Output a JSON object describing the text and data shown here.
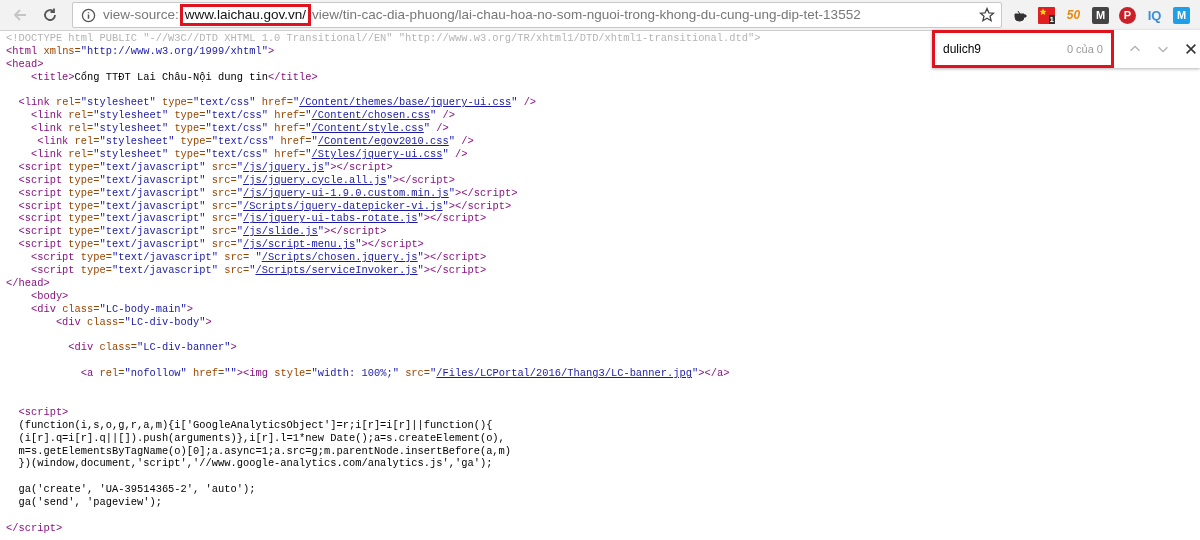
{
  "toolbar": {
    "back_disabled": true,
    "address": [
      {
        "kind": "scheme",
        "text": "view-source:",
        "highlighted": false
      },
      {
        "kind": "host",
        "text": "www.laichau.gov.vn/",
        "highlighted": true
      },
      {
        "kind": "path",
        "text": "view/tin-cac-dia-phuong/lai-chau-hoa-no-som-nguoi-trong-khong-du-cung-ung-dip-tet-13552",
        "highlighted": false
      }
    ],
    "extensions": [
      {
        "kind": "cup"
      },
      {
        "kind": "flag",
        "label": "1"
      },
      {
        "kind": "badge",
        "label": "50"
      },
      {
        "kind": "dark",
        "label": "M"
      },
      {
        "kind": "pin",
        "label": "P"
      },
      {
        "kind": "iq",
        "label": "IQ"
      },
      {
        "kind": "blue",
        "label": "M"
      }
    ]
  },
  "find_bar": {
    "value": "dulich9",
    "count": "0 của 0",
    "highlighted": true,
    "prev_disabled": true,
    "next_disabled": true
  },
  "lines": [
    {
      "kind": "code",
      "segs": [
        {
          "kind": "doc",
          "text": "<!DOCTYPE html PUBLIC \"-//W3C//DTD XHTML 1.0 Transitional//EN\" \"http://www.w3.org/TR/xhtml1/DTD/xhtml1-transitional.dtd\">"
        }
      ]
    },
    {
      "kind": "code",
      "segs": [
        {
          "kind": "tag",
          "text": "<html"
        },
        {
          "kind": "attr",
          "text": " xmlns="
        },
        {
          "kind": "val",
          "text": "\"http://www.w3.org/1999/xhtml\""
        },
        {
          "kind": "tag",
          "text": ">"
        }
      ]
    },
    {
      "kind": "code",
      "segs": [
        {
          "kind": "tag",
          "text": "<head>"
        }
      ]
    },
    {
      "kind": "code",
      "segs": [
        {
          "kind": "tag",
          "text": "    <title>"
        },
        {
          "kind": "text",
          "text": "Cổng TTĐT Lai Châu-Nội dung tin"
        },
        {
          "kind": "tag",
          "text": "</title>"
        }
      ]
    },
    {
      "kind": "blank"
    },
    {
      "kind": "code",
      "segs": [
        {
          "kind": "tag",
          "text": "  <link"
        },
        {
          "kind": "attr",
          "text": " rel="
        },
        {
          "kind": "val",
          "text": "\"stylesheet\""
        },
        {
          "kind": "attr",
          "text": " type="
        },
        {
          "kind": "val",
          "text": "\"text/css\""
        },
        {
          "kind": "attr",
          "text": " href="
        },
        {
          "kind": "val",
          "text": "\""
        },
        {
          "kind": "link",
          "text": "/Content/themes/base/jquery-ui.css"
        },
        {
          "kind": "val",
          "text": "\""
        },
        {
          "kind": "tag",
          "text": " />"
        }
      ]
    },
    {
      "kind": "code",
      "segs": [
        {
          "kind": "tag",
          "text": "    <link"
        },
        {
          "kind": "attr",
          "text": " rel="
        },
        {
          "kind": "val",
          "text": "\"stylesheet\""
        },
        {
          "kind": "attr",
          "text": " type="
        },
        {
          "kind": "val",
          "text": "\"text/css\""
        },
        {
          "kind": "attr",
          "text": " href="
        },
        {
          "kind": "val",
          "text": "\""
        },
        {
          "kind": "link",
          "text": "/Content/chosen.css"
        },
        {
          "kind": "val",
          "text": "\""
        },
        {
          "kind": "tag",
          "text": " />"
        }
      ]
    },
    {
      "kind": "code",
      "segs": [
        {
          "kind": "tag",
          "text": "    <link"
        },
        {
          "kind": "attr",
          "text": " rel="
        },
        {
          "kind": "val",
          "text": "\"stylesheet\""
        },
        {
          "kind": "attr",
          "text": " type="
        },
        {
          "kind": "val",
          "text": "\"text/css\""
        },
        {
          "kind": "attr",
          "text": " href="
        },
        {
          "kind": "val",
          "text": "\""
        },
        {
          "kind": "link",
          "text": "/Content/style.css"
        },
        {
          "kind": "val",
          "text": "\""
        },
        {
          "kind": "tag",
          "text": " />"
        }
      ]
    },
    {
      "kind": "code",
      "segs": [
        {
          "kind": "tag",
          "text": "     <link"
        },
        {
          "kind": "attr",
          "text": " rel="
        },
        {
          "kind": "val",
          "text": "\"stylesheet\""
        },
        {
          "kind": "attr",
          "text": " type="
        },
        {
          "kind": "val",
          "text": "\"text/css\""
        },
        {
          "kind": "attr",
          "text": " href="
        },
        {
          "kind": "val",
          "text": "\""
        },
        {
          "kind": "link",
          "text": "/Content/egov2010.css"
        },
        {
          "kind": "val",
          "text": "\""
        },
        {
          "kind": "tag",
          "text": " />"
        }
      ]
    },
    {
      "kind": "code",
      "segs": [
        {
          "kind": "tag",
          "text": "    <link"
        },
        {
          "kind": "attr",
          "text": " rel="
        },
        {
          "kind": "val",
          "text": "\"stylesheet\""
        },
        {
          "kind": "attr",
          "text": " type="
        },
        {
          "kind": "val",
          "text": "\"text/css\""
        },
        {
          "kind": "attr",
          "text": " href="
        },
        {
          "kind": "val",
          "text": "\""
        },
        {
          "kind": "link",
          "text": "/Styles/jquery-ui.css"
        },
        {
          "kind": "val",
          "text": "\""
        },
        {
          "kind": "tag",
          "text": " />"
        }
      ]
    },
    {
      "kind": "code",
      "segs": [
        {
          "kind": "tag",
          "text": "  <script"
        },
        {
          "kind": "attr",
          "text": " type="
        },
        {
          "kind": "val",
          "text": "\"text/javascript\""
        },
        {
          "kind": "attr",
          "text": " src="
        },
        {
          "kind": "val",
          "text": "\""
        },
        {
          "kind": "link",
          "text": "/js/jquery.js"
        },
        {
          "kind": "val",
          "text": "\""
        },
        {
          "kind": "tag",
          "text": "></script>"
        }
      ]
    },
    {
      "kind": "code",
      "segs": [
        {
          "kind": "tag",
          "text": "  <script"
        },
        {
          "kind": "attr",
          "text": " type="
        },
        {
          "kind": "val",
          "text": "\"text/javascript\""
        },
        {
          "kind": "attr",
          "text": " src="
        },
        {
          "kind": "val",
          "text": "\""
        },
        {
          "kind": "link",
          "text": "/js/jquery.cycle.all.js"
        },
        {
          "kind": "val",
          "text": "\""
        },
        {
          "kind": "tag",
          "text": "></script>"
        }
      ]
    },
    {
      "kind": "code",
      "segs": [
        {
          "kind": "tag",
          "text": "  <script"
        },
        {
          "kind": "attr",
          "text": " type="
        },
        {
          "kind": "val",
          "text": "\"text/javascript\""
        },
        {
          "kind": "attr",
          "text": " src="
        },
        {
          "kind": "val",
          "text": "\""
        },
        {
          "kind": "link",
          "text": "/js/jquery-ui-1.9.0.custom.min.js"
        },
        {
          "kind": "val",
          "text": "\""
        },
        {
          "kind": "tag",
          "text": "></script>"
        }
      ]
    },
    {
      "kind": "code",
      "segs": [
        {
          "kind": "tag",
          "text": "  <script"
        },
        {
          "kind": "attr",
          "text": " type="
        },
        {
          "kind": "val",
          "text": "\"text/javascript\""
        },
        {
          "kind": "attr",
          "text": " src="
        },
        {
          "kind": "val",
          "text": "\""
        },
        {
          "kind": "link",
          "text": "/Scripts/jquery-datepicker-vi.js"
        },
        {
          "kind": "val",
          "text": "\""
        },
        {
          "kind": "tag",
          "text": "></script>"
        }
      ]
    },
    {
      "kind": "code",
      "segs": [
        {
          "kind": "tag",
          "text": "  <script"
        },
        {
          "kind": "attr",
          "text": " type="
        },
        {
          "kind": "val",
          "text": "\"text/javascript\""
        },
        {
          "kind": "attr",
          "text": " src="
        },
        {
          "kind": "val",
          "text": "\""
        },
        {
          "kind": "link",
          "text": "/js/jquery-ui-tabs-rotate.js"
        },
        {
          "kind": "val",
          "text": "\""
        },
        {
          "kind": "tag",
          "text": "></script>"
        }
      ]
    },
    {
      "kind": "code",
      "segs": [
        {
          "kind": "tag",
          "text": "  <script"
        },
        {
          "kind": "attr",
          "text": " type="
        },
        {
          "kind": "val",
          "text": "\"text/javascript\""
        },
        {
          "kind": "attr",
          "text": " src="
        },
        {
          "kind": "val",
          "text": "\""
        },
        {
          "kind": "link",
          "text": "/js/slide.js"
        },
        {
          "kind": "val",
          "text": "\""
        },
        {
          "kind": "tag",
          "text": "></script>"
        }
      ]
    },
    {
      "kind": "code",
      "segs": [
        {
          "kind": "tag",
          "text": "  <script"
        },
        {
          "kind": "attr",
          "text": " type="
        },
        {
          "kind": "val",
          "text": "\"text/javascript\""
        },
        {
          "kind": "attr",
          "text": " src="
        },
        {
          "kind": "val",
          "text": "\""
        },
        {
          "kind": "link",
          "text": "/js/script-menu.js"
        },
        {
          "kind": "val",
          "text": "\""
        },
        {
          "kind": "tag",
          "text": "></script>"
        }
      ]
    },
    {
      "kind": "code",
      "segs": [
        {
          "kind": "tag",
          "text": "    <script"
        },
        {
          "kind": "attr",
          "text": " type="
        },
        {
          "kind": "val",
          "text": "\"text/javascript\""
        },
        {
          "kind": "attr",
          "text": " src= "
        },
        {
          "kind": "val",
          "text": "\""
        },
        {
          "kind": "link",
          "text": "/Scripts/chosen.jquery.js"
        },
        {
          "kind": "val",
          "text": "\""
        },
        {
          "kind": "tag",
          "text": "></script>"
        }
      ]
    },
    {
      "kind": "code",
      "segs": [
        {
          "kind": "tag",
          "text": "    <script"
        },
        {
          "kind": "attr",
          "text": " type="
        },
        {
          "kind": "val",
          "text": "\"text/javascript\""
        },
        {
          "kind": "attr",
          "text": " src="
        },
        {
          "kind": "val",
          "text": "\""
        },
        {
          "kind": "link",
          "text": "/Scripts/serviceInvoker.js"
        },
        {
          "kind": "val",
          "text": "\""
        },
        {
          "kind": "tag",
          "text": "></script>"
        }
      ]
    },
    {
      "kind": "code",
      "segs": [
        {
          "kind": "tag",
          "text": "</head>"
        }
      ]
    },
    {
      "kind": "code",
      "segs": [
        {
          "kind": "tag",
          "text": "    <body>"
        }
      ]
    },
    {
      "kind": "code",
      "segs": [
        {
          "kind": "tag",
          "text": "    <div"
        },
        {
          "kind": "attr",
          "text": " class="
        },
        {
          "kind": "val",
          "text": "\"LC-body-main\""
        },
        {
          "kind": "tag",
          "text": ">"
        }
      ]
    },
    {
      "kind": "code",
      "segs": [
        {
          "kind": "tag",
          "text": "        <div"
        },
        {
          "kind": "attr",
          "text": " class="
        },
        {
          "kind": "val",
          "text": "\"LC-div-body\""
        },
        {
          "kind": "tag",
          "text": ">"
        }
      ]
    },
    {
      "kind": "blank"
    },
    {
      "kind": "code",
      "segs": [
        {
          "kind": "tag",
          "text": "          <div"
        },
        {
          "kind": "attr",
          "text": " class="
        },
        {
          "kind": "val",
          "text": "\"LC-div-banner\""
        },
        {
          "kind": "tag",
          "text": ">"
        }
      ]
    },
    {
      "kind": "blank"
    },
    {
      "kind": "code",
      "segs": [
        {
          "kind": "tag",
          "text": "            <a"
        },
        {
          "kind": "attr",
          "text": " rel="
        },
        {
          "kind": "val",
          "text": "\"nofollow\""
        },
        {
          "kind": "attr",
          "text": " href="
        },
        {
          "kind": "val",
          "text": "\"\""
        },
        {
          "kind": "tag",
          "text": "><img"
        },
        {
          "kind": "attr",
          "text": " style="
        },
        {
          "kind": "val",
          "text": "\"width: 100%;\""
        },
        {
          "kind": "attr",
          "text": " src="
        },
        {
          "kind": "val",
          "text": "\""
        },
        {
          "kind": "link",
          "text": "/Files/LCPortal/2016/Thang3/LC-banner.jpg"
        },
        {
          "kind": "val",
          "text": "\""
        },
        {
          "kind": "tag",
          "text": "></a>"
        }
      ]
    },
    {
      "kind": "blank"
    },
    {
      "kind": "blank"
    },
    {
      "kind": "code",
      "segs": [
        {
          "kind": "tag",
          "text": "  <script>"
        }
      ]
    },
    {
      "kind": "code",
      "segs": [
        {
          "kind": "text",
          "text": "  (function(i,s,o,g,r,a,m){i['GoogleAnalyticsObject']=r;i[r]=i[r]||function(){"
        }
      ]
    },
    {
      "kind": "code",
      "segs": [
        {
          "kind": "text",
          "text": "  (i[r].q=i[r].q||[]).push(arguments)},i[r].l=1*new Date();a=s.createElement(o),"
        }
      ]
    },
    {
      "kind": "code",
      "segs": [
        {
          "kind": "text",
          "text": "  m=s.getElementsByTagName(o)[0];a.async=1;a.src=g;m.parentNode.insertBefore(a,m)"
        }
      ]
    },
    {
      "kind": "code",
      "segs": [
        {
          "kind": "text",
          "text": "  })(window,document,'script','//www.google-analytics.com/analytics.js','ga');"
        }
      ]
    },
    {
      "kind": "blank"
    },
    {
      "kind": "code",
      "segs": [
        {
          "kind": "text",
          "text": "  ga('create', 'UA-39514365-2', 'auto');"
        }
      ]
    },
    {
      "kind": "code",
      "segs": [
        {
          "kind": "text",
          "text": "  ga('send', 'pageview');"
        }
      ]
    },
    {
      "kind": "blank"
    },
    {
      "kind": "code",
      "segs": [
        {
          "kind": "tag",
          "text": "</script>"
        }
      ]
    }
  ]
}
